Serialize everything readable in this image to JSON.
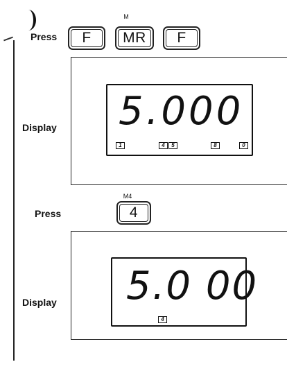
{
  "step1": {
    "press_label": "Press",
    "keys": [
      {
        "legend": "",
        "label": "F"
      },
      {
        "legend": "M",
        "label": "MR"
      },
      {
        "legend": "",
        "label": "F"
      }
    ],
    "display_label": "Display",
    "readout": "5.000",
    "annunciators": [
      "1",
      "4",
      "5",
      "8",
      "0"
    ]
  },
  "step2": {
    "press_label": "Press",
    "keys": [
      {
        "legend": "M4",
        "label": "4"
      }
    ],
    "display_label": "Display",
    "readout": "5.0 00",
    "annunciators": [
      "4"
    ]
  }
}
